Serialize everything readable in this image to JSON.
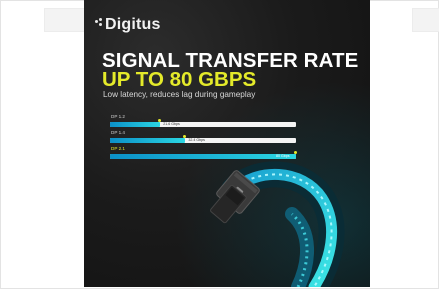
{
  "banner": {
    "brand": "Digitus",
    "headline": "SIGNAL TRANSFER RATE",
    "headline_accent": "UP TO 80 GBPS",
    "tagline": "Low latency, reduces lag during gameplay",
    "colors": {
      "accent": "#e4ea2a",
      "bar_fill": "#12a9d6",
      "background": "#1b1b1b"
    }
  },
  "chart_data": {
    "type": "bar",
    "orientation": "horizontal",
    "categories": [
      "DP 1.2",
      "DP 1.4",
      "DP 2.1"
    ],
    "values": [
      21.6,
      32.4,
      80
    ],
    "value_labels": [
      "21.6 Gbps",
      "32.4 Gbps",
      "80 Gbps"
    ],
    "xlim": [
      0,
      80
    ],
    "highlighted": "DP 2.1"
  }
}
